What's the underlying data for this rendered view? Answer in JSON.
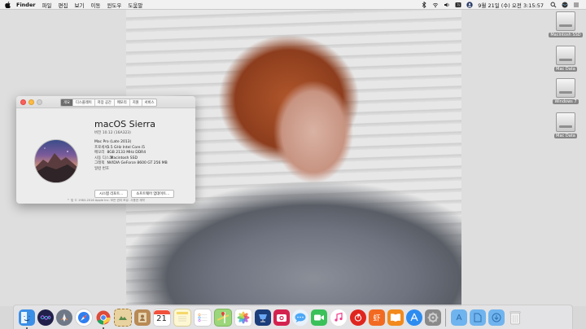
{
  "menubar": {
    "app_name": "Finder",
    "menus": [
      "파일",
      "편집",
      "보기",
      "이동",
      "윈도우",
      "도움말"
    ],
    "clock": "9월 21일 (수) 오전 3:15:57"
  },
  "desktop": {
    "drives": [
      {
        "label": "Macintosh SSD"
      },
      {
        "label": "Mac Data"
      },
      {
        "label": "Windows 7"
      },
      {
        "label": "Mac Data"
      }
    ]
  },
  "about_window": {
    "tabs": [
      "개요",
      "디스플레이",
      "저장 공간",
      "메모리",
      "지원",
      "서비스"
    ],
    "active_tab_index": 0,
    "os_name": "macOS Sierra",
    "version": "버전 10.12 (16A323)",
    "model": "Mac Pro (Late 2013)",
    "specs": [
      {
        "key": "프로세서",
        "value": "3.5 GHz Intel Core i5"
      },
      {
        "key": "메모리",
        "value": "8GB 2133 MHz DDR4"
      },
      {
        "key": "시동 디스크",
        "value": "Macintosh SSD"
      },
      {
        "key": "그래픽",
        "value": "NVIDIA GeForce 8600 GT 256 MB"
      },
      {
        "key": "일련 번호",
        "value": ""
      }
    ],
    "buttons": {
      "system_report": "시스템 리포트...",
      "software_update": "소프트웨어 업데이트..."
    },
    "copyright": "™ 및 © 1983-2016 Apple Inc. 모든 권리 보유.  사용권 계약"
  },
  "dock": {
    "date_badge": "21",
    "apps": [
      {
        "icon": "finder-icon",
        "color": "#3b8fe6"
      },
      {
        "icon": "siri-icon",
        "color": "#2e2e6e"
      },
      {
        "icon": "launchpad-icon",
        "color": "#5b6472"
      },
      {
        "icon": "safari-icon",
        "color": "#2f7ff0"
      },
      {
        "icon": "chrome-icon",
        "color": "#dd4b39"
      },
      {
        "icon": "mail-stamp-icon",
        "color": "#c7a15a"
      },
      {
        "icon": "contacts-icon",
        "color": "#b88a55"
      },
      {
        "icon": "calendar-icon",
        "color": "#ffffff"
      },
      {
        "icon": "notes-icon",
        "color": "#f5d86b"
      },
      {
        "icon": "reminders-icon",
        "color": "#fafafa"
      },
      {
        "icon": "maps-icon",
        "color": "#6cbf5b"
      },
      {
        "icon": "photos-icon",
        "color": "#f2f2f2"
      },
      {
        "icon": "keynote-icon",
        "color": "#1c3e7a"
      },
      {
        "icon": "photo-booth-icon",
        "color": "#d4224f"
      },
      {
        "icon": "messages-icon",
        "color": "#4da8f7"
      },
      {
        "icon": "facetime-icon",
        "color": "#3ac15a"
      },
      {
        "icon": "itunes-icon",
        "color": "#f03e8c"
      },
      {
        "icon": "netease-music-icon",
        "color": "#e0251f"
      },
      {
        "icon": "xiami-icon",
        "color": "#f26a21"
      },
      {
        "icon": "ibooks-icon",
        "color": "#f28a1c"
      },
      {
        "icon": "app-store-icon",
        "color": "#2d8cf0"
      },
      {
        "icon": "system-preferences-icon",
        "color": "#8a8a8a"
      }
    ],
    "folders": [
      {
        "icon": "applications-folder-icon",
        "color": "#6fb4ee"
      },
      {
        "icon": "documents-folder-icon",
        "color": "#6fb4ee"
      },
      {
        "icon": "downloads-folder-icon",
        "color": "#6fb4ee"
      }
    ],
    "trash": {
      "icon": "trash-icon",
      "color": "#d7d7d7"
    }
  }
}
